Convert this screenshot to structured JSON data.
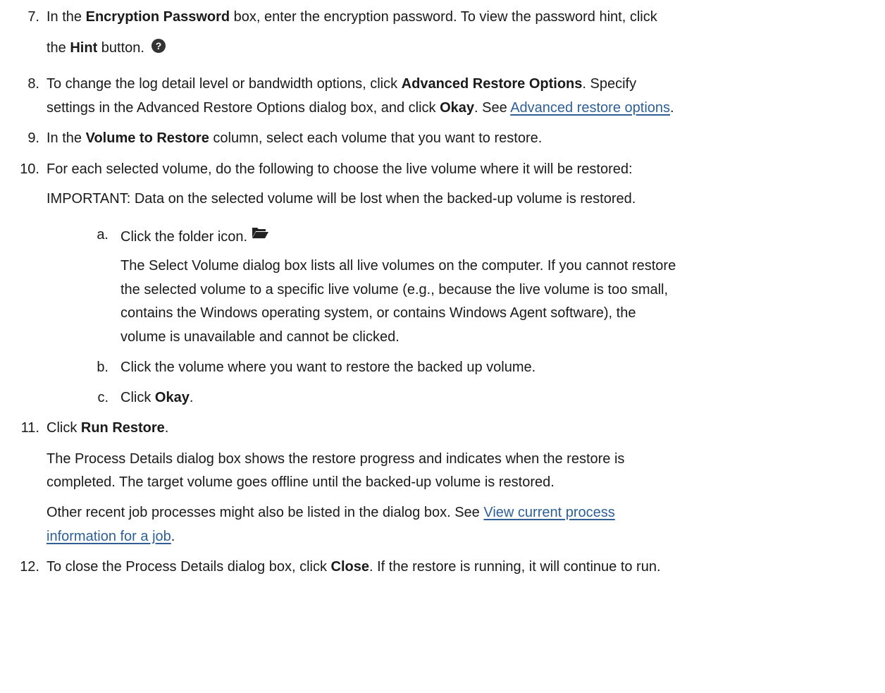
{
  "steps": {
    "s7": {
      "number": "7.",
      "line1": {
        "pre": "In the ",
        "b1": "Encryption Password",
        "post": " box, enter the encryption password. To view the password hint, click"
      },
      "line2": {
        "pre": "the ",
        "b1": "Hint",
        "post": " button."
      },
      "icon": "question-circle-icon"
    },
    "s8": {
      "number": "8.",
      "line1": {
        "pre": "To change the log detail level or bandwidth options, click ",
        "b1": "Advanced Restore Options",
        "post": ". Specify"
      },
      "line2": {
        "pre": "settings in the Advanced Restore Options dialog box, and click ",
        "b1": "Okay",
        "mid": ". See ",
        "link": "Advanced restore options",
        "post": "."
      }
    },
    "s9": {
      "number": "9.",
      "pre": "In the ",
      "b1": "Volume to Restore",
      "post": " column, select each volume that you want to restore."
    },
    "s10": {
      "number": "10.",
      "text": "For each selected volume, do the following to choose the live volume where it will be restored:",
      "important": "IMPORTANT: Data on the selected volume will be lost when the backed-up volume is restored.",
      "substeps": {
        "a": {
          "letter": "a.",
          "text": "Click the folder icon.",
          "icon": "folder-open-icon",
          "para": [
            "The Select Volume dialog box lists all live volumes on the computer. If you cannot restore",
            "the selected volume to a specific live volume (e.g., because the live volume is too small,",
            "contains the Windows operating system, or contains Windows Agent software), the",
            "volume is unavailable and cannot be clicked."
          ]
        },
        "b": {
          "letter": "b.",
          "text": "Click the volume where you want to restore the backed up volume."
        },
        "c": {
          "letter": "c.",
          "pre": "Click ",
          "b1": "Okay",
          "post": "."
        }
      }
    },
    "s11": {
      "number": "11.",
      "pre": "Click ",
      "b1": "Run Restore",
      "post": ".",
      "para1": [
        "The Process Details dialog box shows the restore progress and indicates when the restore is",
        "completed. The target volume goes offline until the backed-up volume is restored."
      ],
      "para2_pre": "Other recent job processes might also be listed in the dialog box. See ",
      "link_line1": "View current process",
      "link_line2": "information for a job",
      "para2_post": "."
    },
    "s12": {
      "number": "12.",
      "pre": "To close the Process Details dialog box, click ",
      "b1": "Close",
      "post": ". If the restore is running, it will continue to run."
    }
  },
  "colors": {
    "text": "#1a1a1a",
    "link": "#2f5f95",
    "icon": "#333333"
  }
}
